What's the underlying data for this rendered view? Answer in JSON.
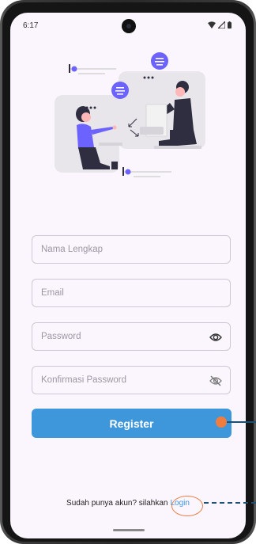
{
  "status_bar": {
    "time": "6:17",
    "icons": [
      "wifi-icon",
      "signal-icon",
      "battery-icon"
    ]
  },
  "illustration": {
    "name": "two people communicating via chat bubbles",
    "colors": {
      "accent": "#6c63ff",
      "dark": "#2f2e41",
      "gray": "#e6e6e6"
    }
  },
  "form": {
    "full_name_placeholder": "Nama Lengkap",
    "email_placeholder": "Email",
    "password_placeholder": "Password",
    "confirm_password_placeholder": "Konfirmasi Password",
    "password_visibility_icon": "eye-icon",
    "confirm_visibility_icon": "eye-off-icon"
  },
  "register_button": {
    "label": "Register",
    "color": "#3e96db"
  },
  "login_prompt": {
    "text": "Sudah punya akun? silahkan",
    "link_label": "Login"
  },
  "annotations": {
    "color": "#ef7d3f",
    "line_color": "#1d4f70"
  }
}
